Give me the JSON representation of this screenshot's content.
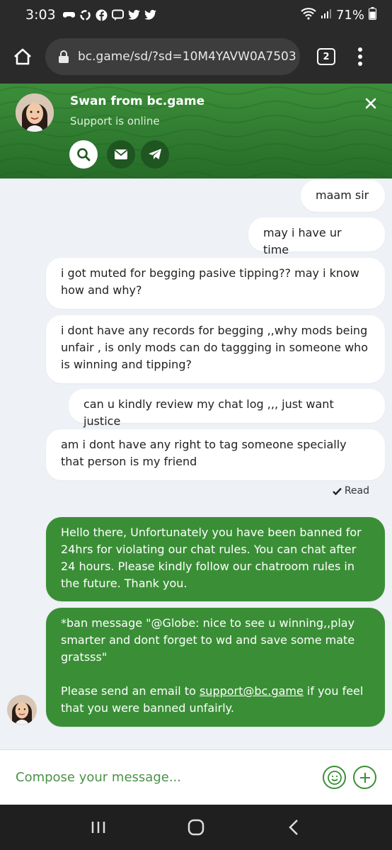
{
  "status_bar": {
    "time": "3:03",
    "battery": "71%",
    "notification_icons": [
      "game-controller-icon",
      "recycle-icon",
      "facebook-icon",
      "message-icon",
      "twitter-icon",
      "twitter-icon"
    ]
  },
  "browser": {
    "url": "bc.game/sd/?sd=10M4YAVW0A7503",
    "tab_count": "2"
  },
  "chat_header": {
    "agent_name": "Swan from bc.game",
    "agent_status": "Support is online",
    "accent_color": "#3a8f36"
  },
  "messages": [
    {
      "from": "user",
      "text": "maam sir"
    },
    {
      "from": "user",
      "text": "may i have ur time"
    },
    {
      "from": "user",
      "text": "i got muted for begging pasive tipping?? may i know how and why?"
    },
    {
      "from": "user",
      "text": "i dont have any records for begging ,,why mods being unfair , is only mods can do taggging in someone who is winning and tipping?"
    },
    {
      "from": "user",
      "text": "can u kindly review my chat log ,,, just want justice"
    },
    {
      "from": "user",
      "text": "am i dont have any right to tag someone specially that person is my friend"
    },
    {
      "from": "agent",
      "text": "Hello there, Unfortunately you have been banned for 24hrs for violating our chat rules. You can chat after 24 hours. Please kindly follow our chatroom rules in the future. Thank you."
    },
    {
      "from": "agent",
      "text_1": "*ban message \"@Globe: nice to see u winning,,play smarter and dont forget to wd and save some mate gratsss\"",
      "text_2_prefix": "Please send an email to ",
      "text_2_link": "support@bc.game",
      "text_2_suffix": " if you feel that you were banned unfairly."
    }
  ],
  "read_label": "Read",
  "composer": {
    "placeholder": "Compose your message..."
  }
}
